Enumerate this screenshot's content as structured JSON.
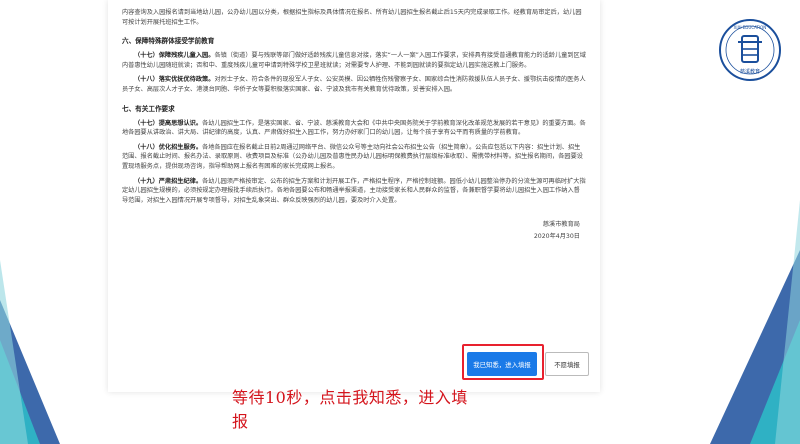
{
  "logo": {
    "text_top": "XIXI EDUCATION",
    "text_bottom": "慈溪教育"
  },
  "doc": {
    "intro_para": "内容查询及入园报名请到当地幼儿园，公办幼儿园以分类，根据招生指标及具体情况在报名、所有幼儿园招生报名截止后15天内完成录取工作。经教育局审定后，幼儿园可按计划开展托班招生工作。",
    "section6_title": "六、保障特殊群体接受学前教育",
    "p17_head": "（十七）保障残疾儿童入园。",
    "p17_body": "各镇（街道）要与残联等部门做好适龄残疾儿童信息对接，落实“一人一案”入园工作要求，安排具有接受普通教育能力的适龄儿童到区域内普惠性幼儿园随班就读；否和中、重度残疾儿童可申请到特殊学校卫星班就读；对需要专人护理、不能到园就读的要指定幼儿园实施送教上门服务。",
    "p18_head": "（十八）落实优抚优待政策。",
    "p18_body": "对烈士子女、符合条件的现役军人子女、公安英模、因公牺牲伤残警察子女、国家综合性消防救援队伍人员子女、援鄂抗击疫情的医务人员子女、高层次人才子女、港澳台同胞、华侨子女等要积极落实国家、省、宁波及我市有关教育优待政策，妥善安排入园。",
    "section7_title": "七、有关工作要求",
    "p17b_head": "（十七）提高思想认识。",
    "p17b_body": "各幼儿园招生工作，是落实国家、省、宁波、慈溪教育大会和《中共中央国务院关于学前教育深化改革规范发展的若干意见》的重要方面。各地各园要从讲政治、讲大局、讲纪律的高度，认真、严肃做好招生入园工作，努力办好家门口的幼儿园，让每个孩子享有公平而有质量的学前教育。",
    "p18b_head": "（十八）优化招生服务。",
    "p18b_body": "各地各园应在报名截止日前2周通过网络平台、微信公众号等主动向社会公布招生公告（招生简章）。公告应包括以下内容：招生计划、招生范围、报名截止时间、报名办法、录取原则、收费项目及标准（公办幼儿园及普惠性民办幼儿园标明保教费执行层级标准收取）、需携带材料等。招生报名期间，各园要设置现场服务点，提供现场咨询，指导帮助网上报名有困难的家长完成网上报名。",
    "p19_head": "（十九）严肃招生纪律。",
    "p19_body": "各幼儿园须严格按审定、公布的招生方案和计划开展工作，严格招生程序，严格控制班额。园低小幼儿园整治停办的分流生源可再临时扩大指定幼儿园招生规模的，必须按规定办理报批手续后执行。各地各园要公布和畅通举报渠道，主动接受家长和人民群众的监督，各兼职督学要将幼儿园招生入园工作纳入督导范围，对招生入园情况开展专项督导，对招生乱象突出、群众反映强烈的幼儿园，要及时介入处置。",
    "sign_org": "慈溪市教育局",
    "sign_date": "2020年4月30日"
  },
  "buttons": {
    "agree": "我已知悉，进入填报",
    "refuse": "不愿填报"
  },
  "instruction": "等待10秒，点击我知悉，进入填报",
  "colors": {
    "accent": "#1a7ae8",
    "highlight": "#e8212e",
    "instruction": "#d4141c",
    "deco_blue": "#1b4f9c",
    "deco_teal": "#2db9c7"
  }
}
